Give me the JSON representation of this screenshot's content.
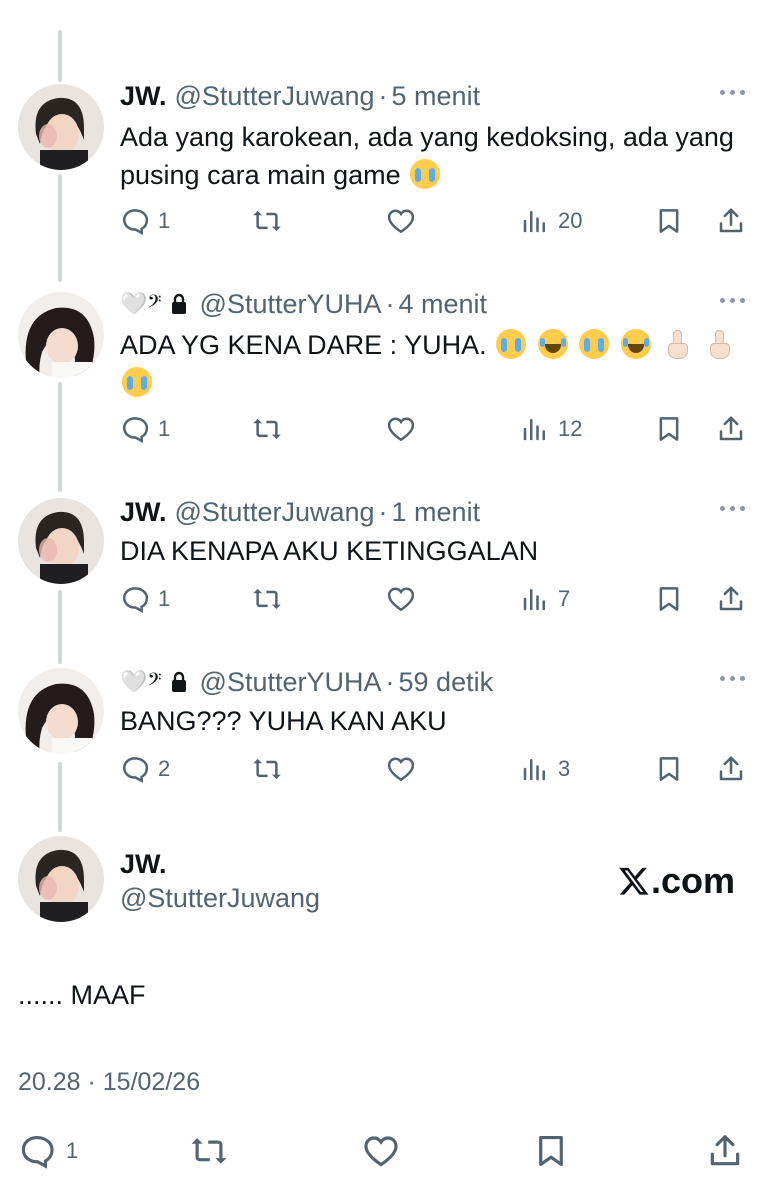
{
  "replies": [
    {
      "name": "JW.",
      "handle": "@StutterJuwang",
      "time": "5 menit",
      "text": "Ada yang karokean, ada yang kedoksing, ada yang pusing cara main game",
      "stats": {
        "replies": "1",
        "views": "20"
      }
    },
    {
      "name": "",
      "badge": "🤍𝄢",
      "handle": "@StutterYUHA",
      "time": "4 menit",
      "text": "ADA YG KENA DARE : YUHA.",
      "stats": {
        "replies": "1",
        "views": "12"
      }
    },
    {
      "name": "JW.",
      "handle": "@StutterJuwang",
      "time": "1 menit",
      "text": "DIA KENAPA AKU KETINGGALAN",
      "stats": {
        "replies": "1",
        "views": "7"
      }
    },
    {
      "name": "",
      "badge": "🤍𝄢",
      "handle": "@StutterYUHA",
      "time": "59 detik",
      "text": "BANG??? YUHA KAN AKU",
      "stats": {
        "replies": "2",
        "views": "3"
      }
    }
  ],
  "main_tweet": {
    "name": "JW.",
    "handle": "@StutterJuwang",
    "text": "...... MAAF",
    "timestamp": "20.28 · 15/02/26",
    "replies": "1",
    "source_logo": ".com"
  },
  "separator": "·",
  "icons": [
    "reply-icon",
    "retweet-icon",
    "like-icon",
    "views-icon",
    "bookmark-icon",
    "share-icon",
    "more-icon",
    "lock-icon"
  ],
  "colors": {
    "text": "#0f1419",
    "muted": "#536471",
    "thread_line": "#cfd9de"
  }
}
